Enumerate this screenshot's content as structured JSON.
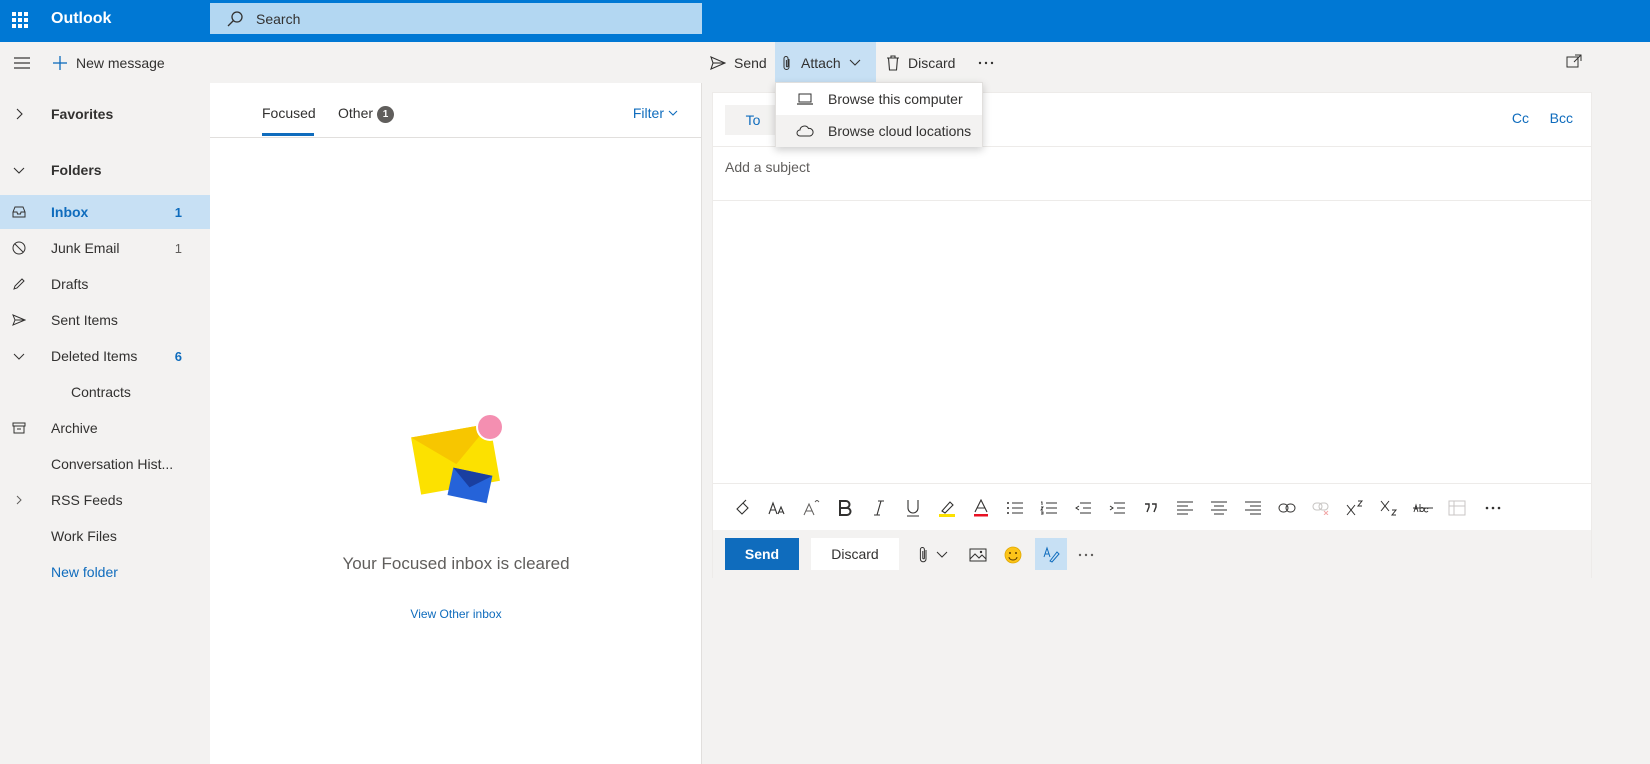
{
  "app": {
    "title": "Outlook"
  },
  "search": {
    "placeholder": "Search"
  },
  "commands": {
    "new_message": "New message",
    "send": "Send",
    "attach": "Attach",
    "discard": "Discard"
  },
  "attach_menu": {
    "items": [
      {
        "label": "Browse this computer",
        "icon": "laptop-icon"
      },
      {
        "label": "Browse cloud locations",
        "icon": "cloud-icon"
      }
    ]
  },
  "nav": {
    "favorites": "Favorites",
    "folders": "Folders",
    "items": [
      {
        "label": "Inbox",
        "count": "1",
        "icon": "inbox-icon"
      },
      {
        "label": "Junk Email",
        "count": "1",
        "icon": "junk-icon"
      },
      {
        "label": "Drafts",
        "count": "",
        "icon": "pencil-icon"
      },
      {
        "label": "Sent Items",
        "count": "",
        "icon": "send-icon"
      },
      {
        "label": "Deleted Items",
        "count": "6",
        "icon": "chevron-down-icon"
      },
      {
        "label": "Contracts",
        "count": "",
        "icon": ""
      },
      {
        "label": "Archive",
        "count": "",
        "icon": "archive-icon"
      },
      {
        "label": "Conversation Hist...",
        "count": "",
        "icon": ""
      },
      {
        "label": "RSS Feeds",
        "count": "",
        "icon": "chevron-right-icon"
      },
      {
        "label": "Work Files",
        "count": "",
        "icon": ""
      }
    ],
    "new_folder": "New folder"
  },
  "message_list": {
    "tabs": [
      {
        "label": "Focused"
      },
      {
        "label": "Other",
        "badge": "1"
      }
    ],
    "filter": "Filter",
    "empty_message": "Your Focused inbox is cleared",
    "view_other": "View Other inbox"
  },
  "compose": {
    "to_label": "To",
    "cc_label": "Cc",
    "bcc_label": "Bcc",
    "subject_placeholder": "Add a subject",
    "send_label": "Send",
    "discard_label": "Discard"
  },
  "colors": {
    "brand": "#0078d4",
    "accent": "#0f6cbd",
    "selected_bg": "#c7e0f4"
  }
}
